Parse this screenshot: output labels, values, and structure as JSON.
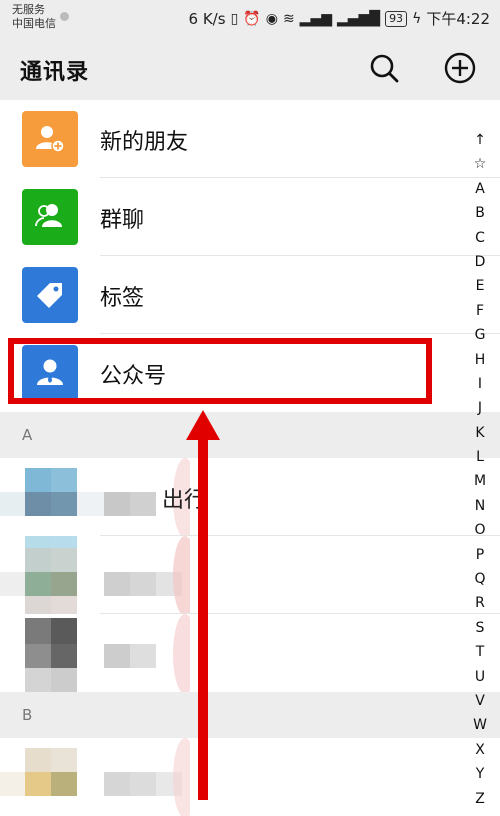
{
  "status": {
    "carrier_line1": "无服务",
    "carrier_line2": "中国电信",
    "speed": "6 K/s",
    "battery": "93",
    "time": "下午4:22"
  },
  "header": {
    "title": "通讯录",
    "search_icon": "search-icon",
    "add_icon": "plus-circle-icon"
  },
  "menu": [
    {
      "label": "新的朋友",
      "icon": "add-friend-icon",
      "color": "#f79c3d"
    },
    {
      "label": "群聊",
      "icon": "group-chat-icon",
      "color": "#1aad19"
    },
    {
      "label": "标签",
      "icon": "tag-icon",
      "color": "#2f7ad8"
    },
    {
      "label": "公众号",
      "icon": "official-account-icon",
      "color": "#2f7ad8"
    }
  ],
  "sections": [
    {
      "letter": "A",
      "contacts": [
        {
          "name": "出行"
        },
        {
          "name": ""
        },
        {
          "name": ""
        }
      ]
    },
    {
      "letter": "B",
      "contacts": [
        {
          "name": ""
        }
      ]
    }
  ],
  "index_letters": [
    "↑",
    "☆",
    "A",
    "B",
    "C",
    "D",
    "E",
    "F",
    "G",
    "H",
    "I",
    "J",
    "K",
    "L",
    "M",
    "N",
    "O",
    "P",
    "Q",
    "R",
    "S",
    "T",
    "U",
    "V",
    "W",
    "X",
    "Y",
    "Z"
  ],
  "annotation_color": "#e00000"
}
